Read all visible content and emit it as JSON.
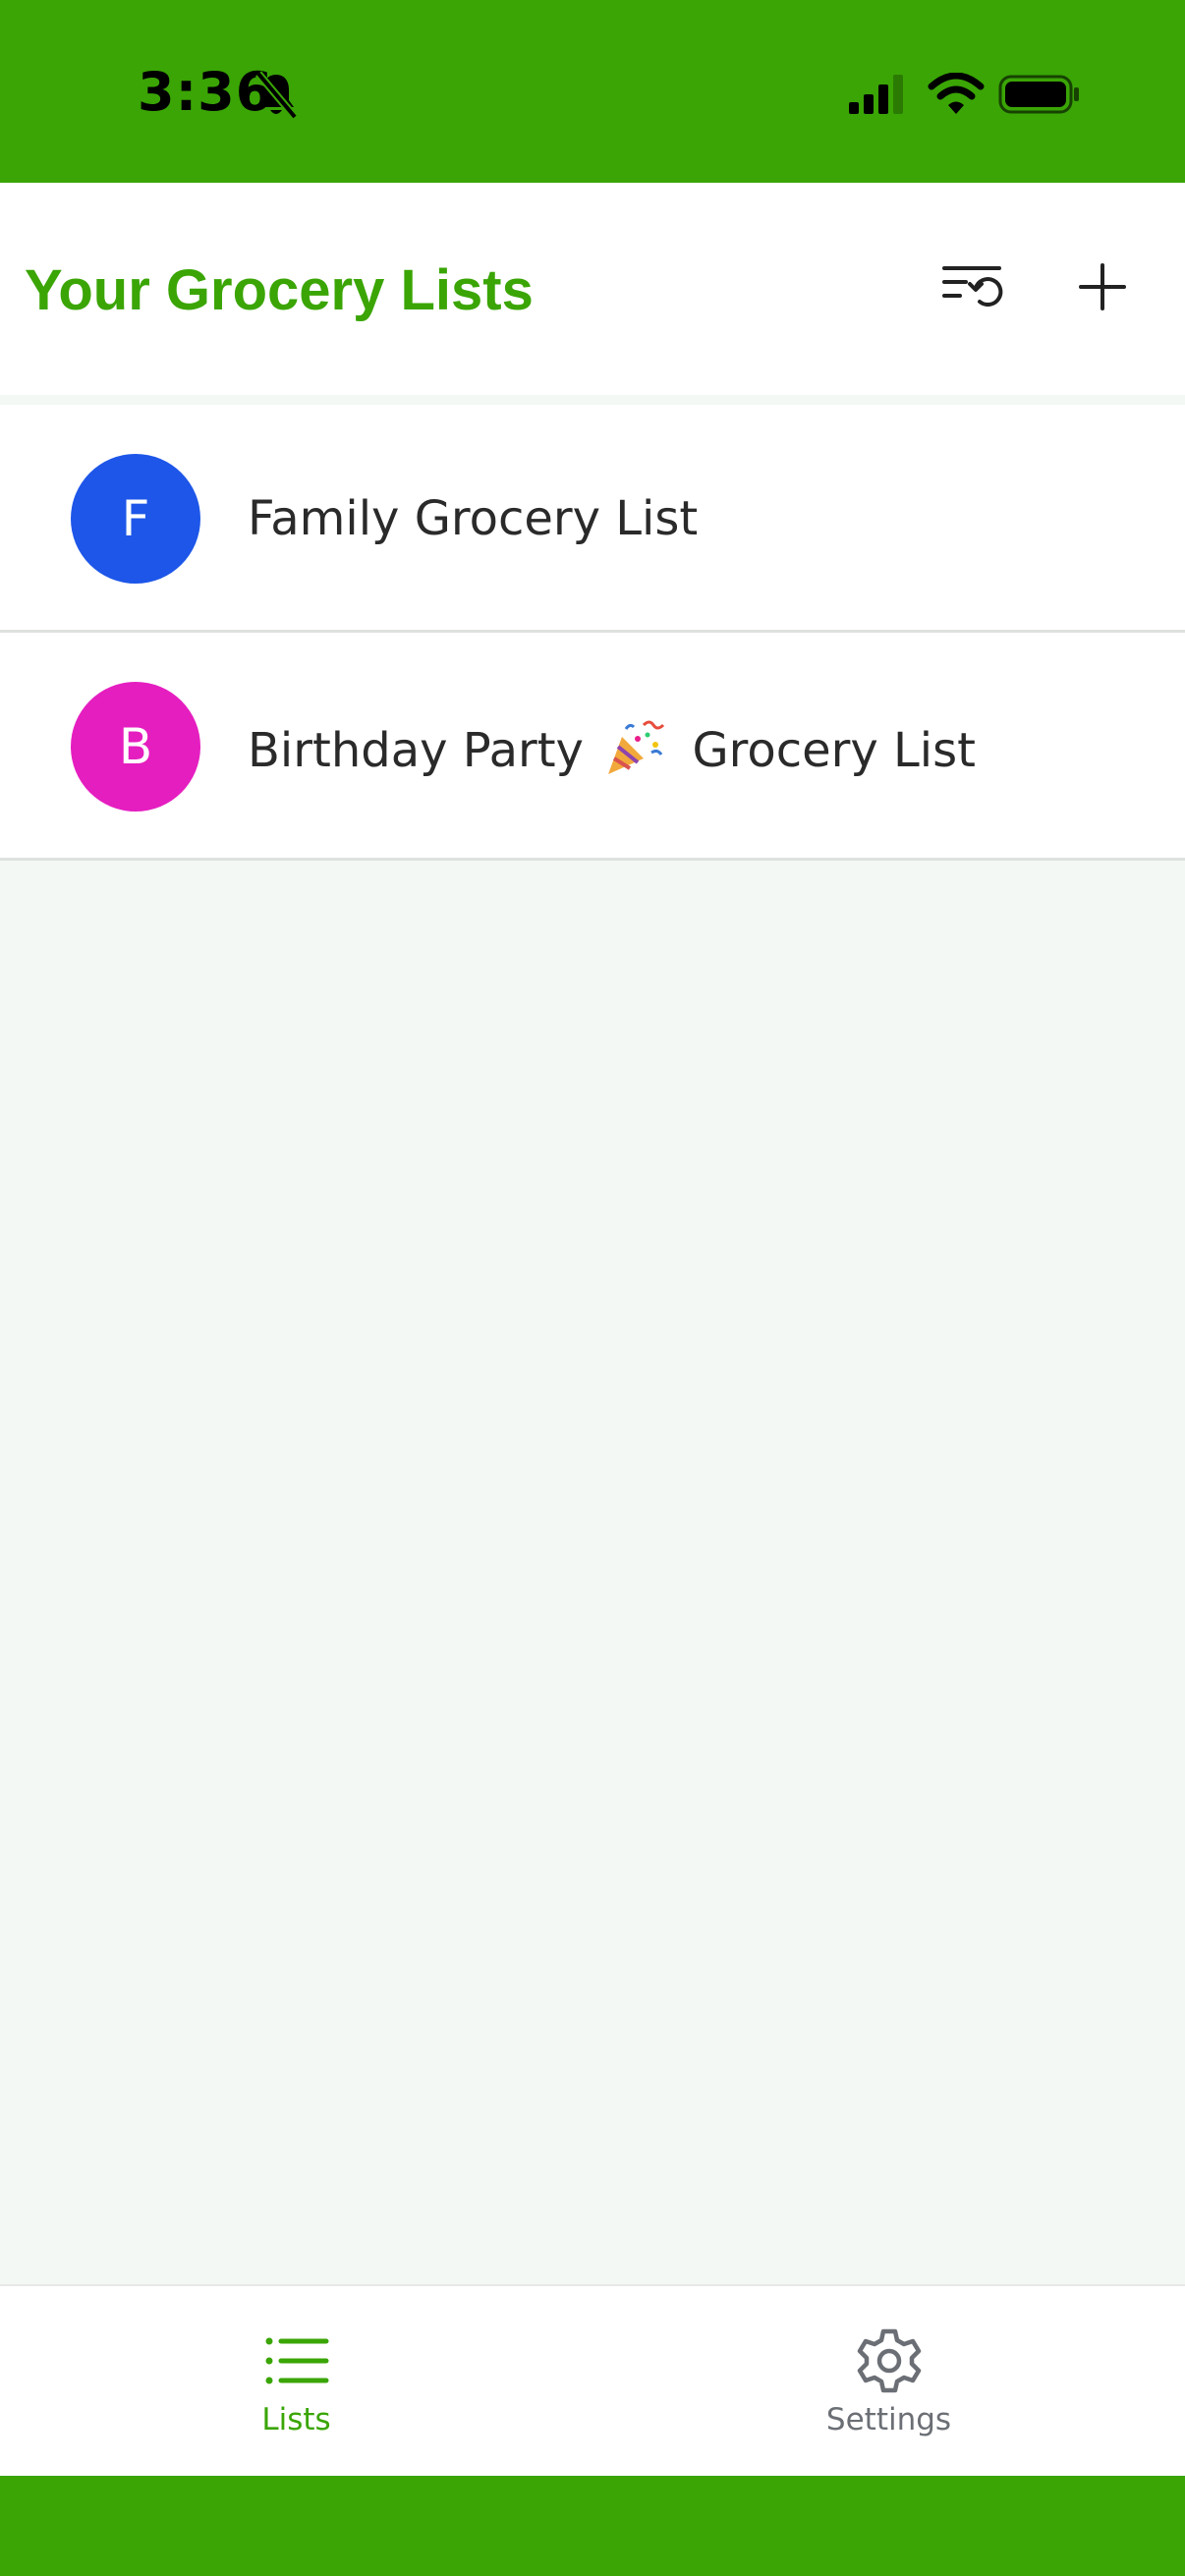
{
  "status_bar": {
    "time": "3:36",
    "icons": [
      "bell-slash-icon",
      "cellular-signal-icon",
      "wifi-icon",
      "battery-icon"
    ]
  },
  "header": {
    "title": "Your Grocery Lists",
    "actions": [
      "restore-list-icon",
      "plus-icon"
    ]
  },
  "lists": [
    {
      "initial": "F",
      "name": "Family Grocery List",
      "avatar_color": "#1d56e8"
    },
    {
      "initial": "B",
      "name_before": "Birthday Party",
      "emoji": "party-popper-icon",
      "name_after": "Grocery List",
      "avatar_color": "#e51ec0"
    }
  ],
  "tabbar": {
    "tabs": [
      {
        "label": "Lists",
        "icon": "list-icon",
        "active": true
      },
      {
        "label": "Settings",
        "icon": "gear-icon",
        "active": false
      }
    ]
  },
  "colors": {
    "brand": "#3aa505",
    "background": "#f3f8f4"
  }
}
